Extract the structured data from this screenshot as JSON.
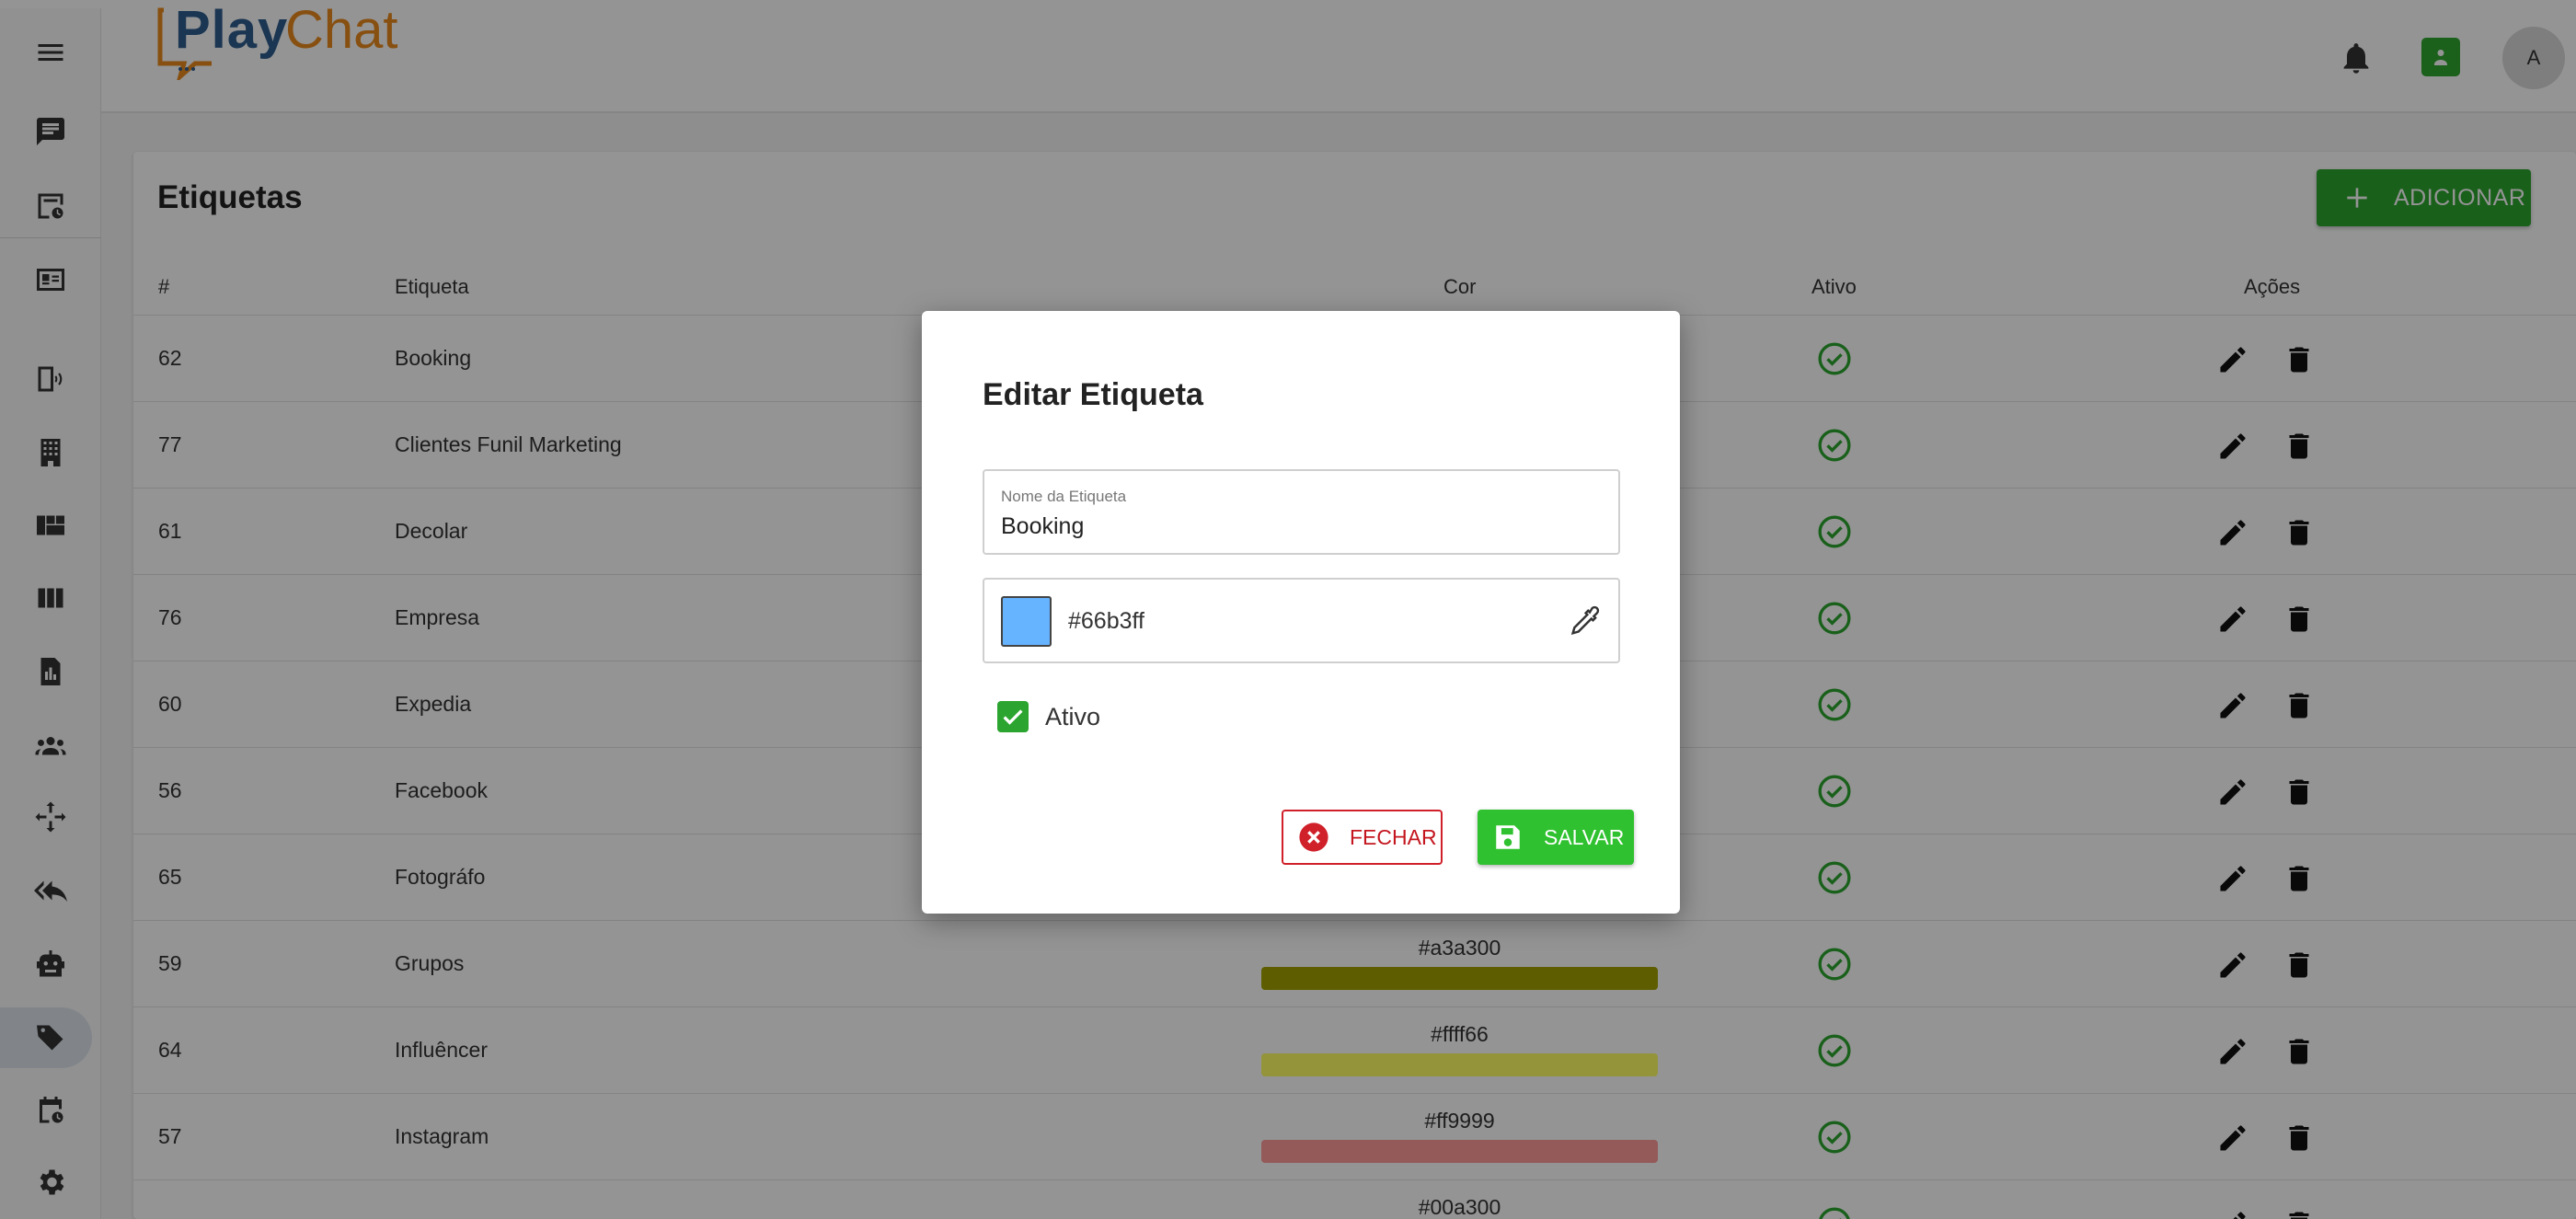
{
  "app": {
    "logo_play": "Play",
    "logo_chat": "Chat",
    "avatar_initial": "A"
  },
  "sidebar": {
    "items": [
      {
        "icon": "menu-icon"
      },
      {
        "icon": "chat-icon"
      },
      {
        "icon": "scheduled-inbox-icon"
      },
      {
        "icon": "contact-card-icon"
      },
      {
        "icon": "device-connections-icon"
      },
      {
        "icon": "building-icon"
      },
      {
        "icon": "dashboard-icon"
      },
      {
        "icon": "kanban-columns-icon"
      },
      {
        "icon": "report-icon"
      },
      {
        "icon": "users-icon"
      },
      {
        "icon": "integrations-icon"
      },
      {
        "icon": "quick-replies-icon"
      },
      {
        "icon": "bot-icon"
      },
      {
        "icon": "tags-icon",
        "active": true
      },
      {
        "icon": "schedule-icon"
      },
      {
        "icon": "settings-icon"
      }
    ]
  },
  "page": {
    "title": "Etiquetas",
    "add_label": "ADICIONAR",
    "columns": [
      "#",
      "Etiqueta",
      "Cor",
      "Ativo",
      "Ações"
    ],
    "rows": [
      {
        "id": "62",
        "name": "Booking",
        "color": "",
        "active": true
      },
      {
        "id": "77",
        "name": "Clientes Funil Marketing",
        "color": "",
        "active": true
      },
      {
        "id": "61",
        "name": "Decolar",
        "color": "",
        "active": true
      },
      {
        "id": "76",
        "name": "Empresa",
        "color": "",
        "active": true
      },
      {
        "id": "60",
        "name": "Expedia",
        "color": "",
        "active": true
      },
      {
        "id": "56",
        "name": "Facebook",
        "color": "",
        "active": true
      },
      {
        "id": "65",
        "name": "Fotográfo",
        "color": "",
        "active": true
      },
      {
        "id": "59",
        "name": "Grupos",
        "color": "#a3a300",
        "active": true
      },
      {
        "id": "64",
        "name": "Influêncer",
        "color": "#ffff66",
        "active": true
      },
      {
        "id": "57",
        "name": "Instagram",
        "color": "#ff9999",
        "active": true
      },
      {
        "id": "",
        "name": "",
        "color": "#00a300",
        "active": true
      }
    ]
  },
  "dialog": {
    "title": "Editar Etiqueta",
    "name_label": "Nome da Etiqueta",
    "name_value": "Booking",
    "color_value": "#66b3ff",
    "active_label": "Ativo",
    "active_checked": true,
    "close_label": "FECHAR",
    "save_label": "SALVAR"
  },
  "colors": {
    "accent_green": "#2ba52f",
    "danger_red": "#d0202a",
    "swatch": "#66b3ff"
  }
}
